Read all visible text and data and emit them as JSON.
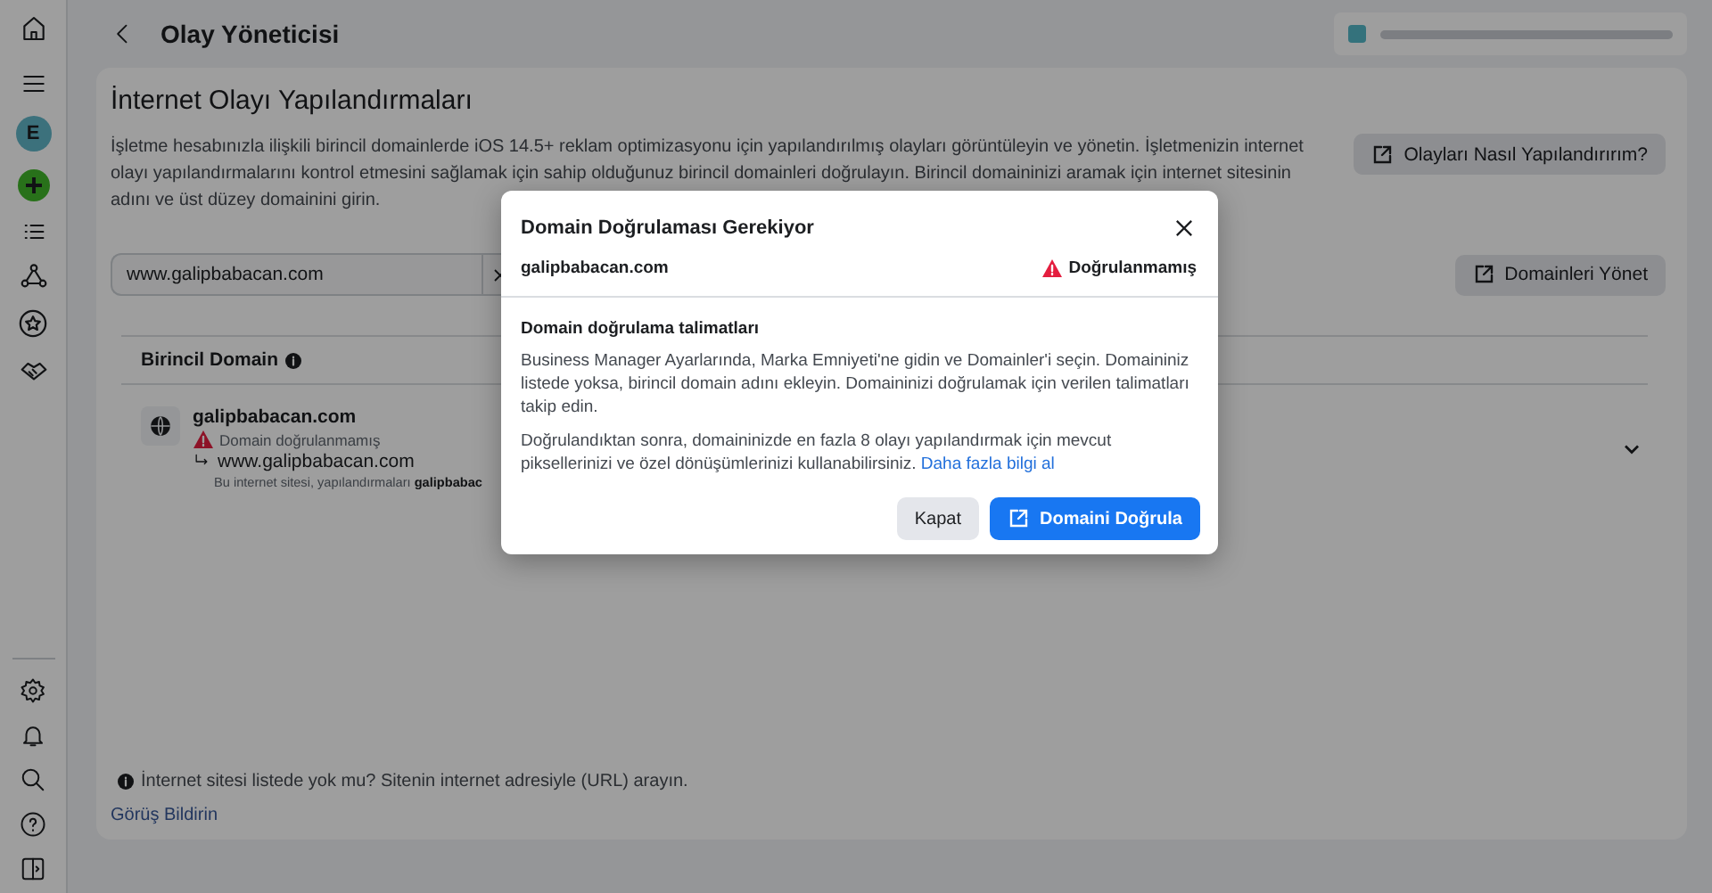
{
  "sidebar": {
    "avatar": "E"
  },
  "header": {
    "title": "Olay Yöneticisi"
  },
  "page": {
    "title": "İnternet Olayı Yapılandırmaları",
    "description": "İşletme hesabınızla ilişkili birincil domainlerde iOS 14.5+ reklam optimizasyonu için yapılandırılmış olayları görüntüleyin ve yönetin. İşletmenizin internet olayı yapılandırmalarını kontrol etmesini sağlamak için sahip olduğunuz birincil domainleri doğrulayın. Birincil domaininizi aramak için internet sitesinin adını ve üst düzey domainini girin.",
    "help_button": "Olayları Nasıl Yapılandırırım?",
    "search": {
      "value": "www.galipbabacan.com"
    },
    "manage_button": "Domainleri Yönet",
    "table": {
      "columns": [
        {
          "label": "Birincil Domain"
        }
      ],
      "rows": [
        {
          "domain": "galipbabacan.com",
          "verified": false,
          "status": "Domain doğrulanmamış",
          "expanded": false,
          "child": {
            "domain": "www.galipbabacan.com",
            "note": "Bu internet sitesi, yapılandırmaları **galipbabac**"
          }
        }
      ]
    },
    "footer_note": "İnternet sitesi listede yok mu? Sitenin internet adresiyle (URL) arayın.",
    "feedback_link": "Görüş Bildirin"
  },
  "dialog": {
    "title": "Domain Doğrulaması Gerekiyor",
    "domain": "galipbabacan.com",
    "verified": false,
    "status": "Doğrulanmamış",
    "section_title": "Domain doğrulama talimatları",
    "paragraphs": [
      "Business Manager Ayarlarında, Marka Emniyeti'ne gidin ve Domainler'i seçin. Domaininiz listede yoksa, birincil domain adını ekleyin. Domaininizi doğrulamak için verilen talimatları takip edin.",
      "Doğrulandıktan sonra, domaininizde en fazla 8 olayı yapılandırmak için mevcut piksellerinizi ve özel dönüşümlerinizi kullanabilirsiniz."
    ],
    "link": "Daha fazla bilgi al",
    "buttons": [
      {
        "label": "Kapat",
        "kind": "secondary"
      },
      {
        "label": "Domaini Doğrula",
        "kind": "primary"
      }
    ]
  }
}
